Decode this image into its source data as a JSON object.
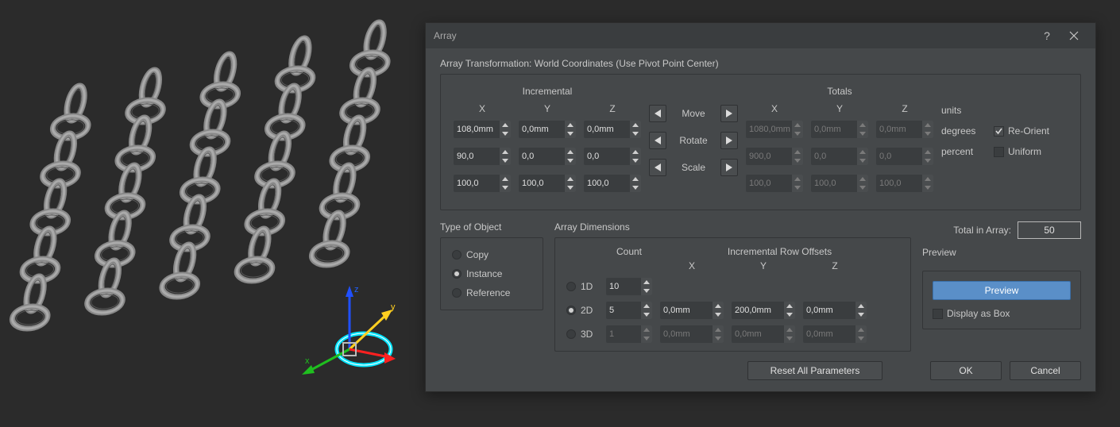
{
  "dialog": {
    "title": "Array",
    "section_label": "Array Transformation: World Coordinates (Use Pivot Point Center)",
    "incremental_label": "Incremental",
    "totals_label": "Totals",
    "axes": {
      "x": "X",
      "y": "Y",
      "z": "Z"
    },
    "rows": {
      "move": {
        "label": "Move",
        "unit": "units",
        "inc": {
          "x": "108,0mm",
          "y": "0,0mm",
          "z": "0,0mm"
        },
        "tot": {
          "x": "1080,0mm",
          "y": "0,0mm",
          "z": "0,0mm"
        }
      },
      "rotate": {
        "label": "Rotate",
        "unit": "degrees",
        "inc": {
          "x": "90,0",
          "y": "0,0",
          "z": "0,0"
        },
        "tot": {
          "x": "900,0",
          "y": "0,0",
          "z": "0,0"
        },
        "reorient": "Re-Orient"
      },
      "scale": {
        "label": "Scale",
        "unit": "percent",
        "inc": {
          "x": "100,0",
          "y": "100,0",
          "z": "100,0"
        },
        "tot": {
          "x": "100,0",
          "y": "100,0",
          "z": "100,0"
        },
        "uniform": "Uniform"
      }
    },
    "type_of_object": {
      "title": "Type of Object",
      "copy": "Copy",
      "instance": "Instance",
      "reference": "Reference"
    },
    "dimensions": {
      "title": "Array Dimensions",
      "count": "Count",
      "offsets": "Incremental Row Offsets",
      "d1": {
        "label": "1D",
        "count": "10"
      },
      "d2": {
        "label": "2D",
        "count": "5",
        "x": "0,0mm",
        "y": "200,0mm",
        "z": "0,0mm"
      },
      "d3": {
        "label": "3D",
        "count": "1",
        "x": "0,0mm",
        "y": "0,0mm",
        "z": "0,0mm"
      }
    },
    "total_label": "Total in Array:",
    "total_value": "50",
    "preview": {
      "title": "Preview",
      "button": "Preview",
      "display_as_box": "Display as Box"
    },
    "footer": {
      "reset": "Reset All Parameters",
      "ok": "OK",
      "cancel": "Cancel"
    }
  }
}
